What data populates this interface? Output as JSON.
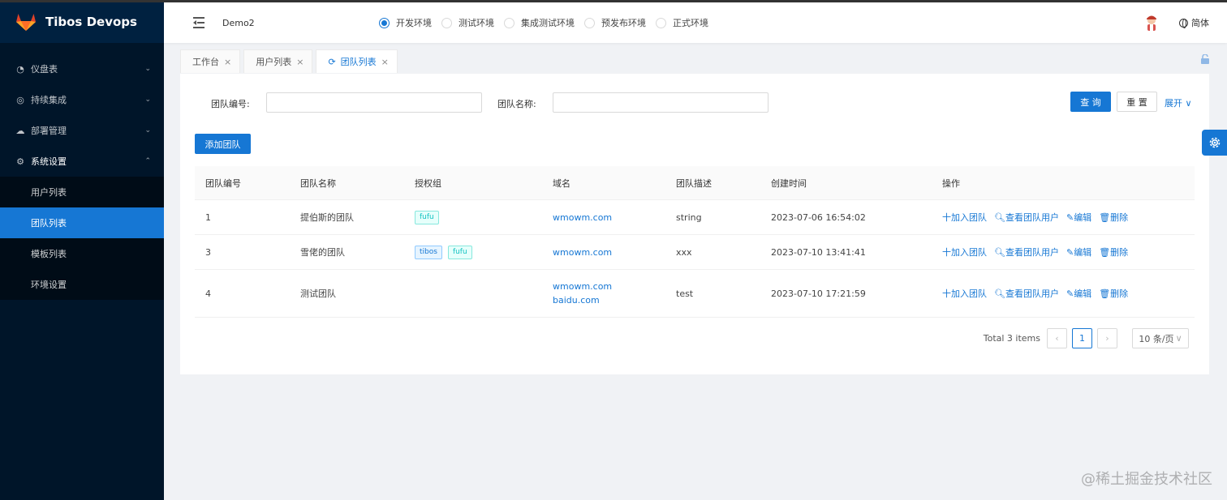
{
  "app": {
    "name": "Tibos Devops"
  },
  "sidebar": {
    "items": [
      {
        "label": "仪盘表",
        "icon": "dashboard-icon",
        "expanded": false
      },
      {
        "label": "持续集成",
        "icon": "ci-icon",
        "expanded": false
      },
      {
        "label": "部署管理",
        "icon": "cloud-icon",
        "expanded": false
      },
      {
        "label": "系统设置",
        "icon": "gear-icon",
        "expanded": true
      }
    ],
    "submenu": [
      {
        "label": "用户列表",
        "active": false
      },
      {
        "label": "团队列表",
        "active": true
      },
      {
        "label": "模板列表",
        "active": false
      },
      {
        "label": "环境设置",
        "active": false
      }
    ]
  },
  "header": {
    "project": "Demo2",
    "environments": [
      {
        "label": "开发环境",
        "checked": true
      },
      {
        "label": "测试环境",
        "checked": false
      },
      {
        "label": "集成测试环境",
        "checked": false
      },
      {
        "label": "预发布环境",
        "checked": false
      },
      {
        "label": "正式环境",
        "checked": false
      }
    ],
    "language": "简体"
  },
  "tabs": [
    {
      "label": "工作台",
      "active": false
    },
    {
      "label": "用户列表",
      "active": false
    },
    {
      "label": "团队列表",
      "active": true
    }
  ],
  "search": {
    "team_no_label": "团队编号:",
    "team_no_value": "",
    "team_name_label": "团队名称:",
    "team_name_value": "",
    "query_button": "查 询",
    "reset_button": "重 置",
    "expand_label": "展开"
  },
  "add_team_button": "添加团队",
  "table": {
    "columns": [
      "团队编号",
      "团队名称",
      "授权组",
      "域名",
      "团队描述",
      "创建时间",
      "操作"
    ],
    "rows": [
      {
        "id": "1",
        "name": "提伯斯的团队",
        "groups": [
          "fufu"
        ],
        "domains": [
          "wmowm.com"
        ],
        "desc": "string",
        "created": "2023-07-06 16:54:02"
      },
      {
        "id": "3",
        "name": "雪佬的团队",
        "groups": [
          "tibos",
          "fufu"
        ],
        "domains": [
          "wmowm.com"
        ],
        "desc": "xxx",
        "created": "2023-07-10 13:41:41"
      },
      {
        "id": "4",
        "name": "测试团队",
        "groups": [],
        "domains": [
          "wmowm.com",
          "baidu.com"
        ],
        "desc": "test",
        "created": "2023-07-10 17:21:59"
      }
    ],
    "actions": [
      "十加入团队",
      "查看团队用户",
      "编辑",
      "删除"
    ]
  },
  "pagination": {
    "total_text": "Total 3 items",
    "current_page": "1",
    "page_size": "10 条/页"
  },
  "watermark": "@稀土掘金技术社区",
  "colors": {
    "primary": "#1677d4",
    "sidebar_bg": "#001529",
    "sidebar_sub_bg": "#000c17"
  }
}
